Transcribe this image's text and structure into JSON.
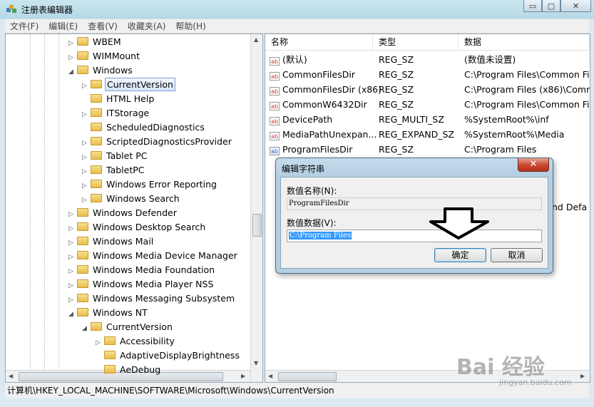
{
  "window": {
    "title": "注册表编辑器",
    "buttons": {
      "minimize": "▭",
      "maximize": "▢",
      "close": "✕"
    }
  },
  "menu": [
    "文件(F)",
    "编辑(E)",
    "查看(V)",
    "收藏夹(A)",
    "帮助(H)"
  ],
  "tree": [
    {
      "label": "WBEM",
      "level": 0,
      "arrow": "▷"
    },
    {
      "label": "WIMMount",
      "level": 0,
      "arrow": "▷"
    },
    {
      "label": "Windows",
      "level": 0,
      "arrow": "◢"
    },
    {
      "label": "CurrentVersion",
      "level": 1,
      "arrow": "▷",
      "selected": true
    },
    {
      "label": "HTML Help",
      "level": 1,
      "arrow": ""
    },
    {
      "label": "ITStorage",
      "level": 1,
      "arrow": "▷"
    },
    {
      "label": "ScheduledDiagnostics",
      "level": 1,
      "arrow": ""
    },
    {
      "label": "ScriptedDiagnosticsProvider",
      "level": 1,
      "arrow": "▷"
    },
    {
      "label": "Tablet PC",
      "level": 1,
      "arrow": "▷"
    },
    {
      "label": "TabletPC",
      "level": 1,
      "arrow": "▷"
    },
    {
      "label": "Windows Error Reporting",
      "level": 1,
      "arrow": "▷"
    },
    {
      "label": "Windows Search",
      "level": 1,
      "arrow": "▷"
    },
    {
      "label": "Windows Defender",
      "level": 0,
      "arrow": "▷"
    },
    {
      "label": "Windows Desktop Search",
      "level": 0,
      "arrow": "▷"
    },
    {
      "label": "Windows Mail",
      "level": 0,
      "arrow": "▷"
    },
    {
      "label": "Windows Media Device Manager",
      "level": 0,
      "arrow": "▷"
    },
    {
      "label": "Windows Media Foundation",
      "level": 0,
      "arrow": "▷"
    },
    {
      "label": "Windows Media Player NSS",
      "level": 0,
      "arrow": "▷"
    },
    {
      "label": "Windows Messaging Subsystem",
      "level": 0,
      "arrow": "▷"
    },
    {
      "label": "Windows NT",
      "level": 0,
      "arrow": "◢"
    },
    {
      "label": "CurrentVersion",
      "level": 1,
      "arrow": "◢"
    },
    {
      "label": "Accessibility",
      "level": 2,
      "arrow": "▷"
    },
    {
      "label": "AdaptiveDisplayBrightness",
      "level": 2,
      "arrow": ""
    },
    {
      "label": "AeDebug",
      "level": 2,
      "arrow": ""
    }
  ],
  "columns": [
    "名称",
    "类型",
    "数据"
  ],
  "values": [
    {
      "name": "(默认)",
      "type": "REG_SZ",
      "data": "(数值未设置)",
      "icon": "ab"
    },
    {
      "name": "CommonFilesDir",
      "type": "REG_SZ",
      "data": "C:\\Program Files\\Common Fil",
      "icon": "ab"
    },
    {
      "name": "CommonFilesDir (x86)",
      "type": "REG_SZ",
      "data": "C:\\Program Files (x86)\\Comm",
      "icon": "ab"
    },
    {
      "name": "CommonW6432Dir",
      "type": "REG_SZ",
      "data": "C:\\Program Files\\Common Fil",
      "icon": "ab"
    },
    {
      "name": "DevicePath",
      "type": "REG_MULTI_SZ",
      "data": "%SystemRoot%\\inf",
      "icon": "ab"
    },
    {
      "name": "MediaPathUnexpan...",
      "type": "REG_EXPAND_SZ",
      "data": "%SystemRoot%\\Media",
      "icon": "ab"
    },
    {
      "name": "ProgramFilesDir",
      "type": "REG_SZ",
      "data": "C:\\Program Files",
      "icon": "bin"
    }
  ],
  "hidden_row_fragment": "nd Defa",
  "statusbar": "计算机\\HKEY_LOCAL_MACHINE\\SOFTWARE\\Microsoft\\Windows\\CurrentVersion",
  "dialog": {
    "title": "编辑字符串",
    "close": "✕",
    "name_label": "数值名称(N):",
    "name_value": "ProgramFilesDir",
    "data_label": "数值数据(V):",
    "data_value": "C:\\Program Files",
    "ok": "确定",
    "cancel": "取消"
  },
  "watermark": {
    "brand": "Bai 经验",
    "url": "jingyan.baidu.com"
  }
}
